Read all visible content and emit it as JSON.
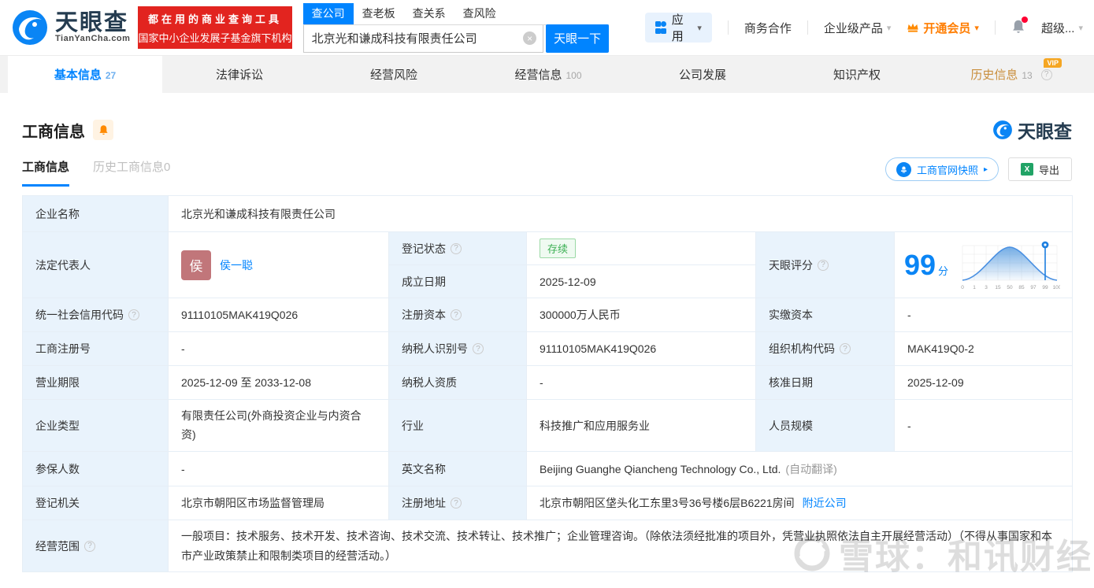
{
  "brand": {
    "name": "天眼查",
    "domain": "TianYanCha.com",
    "promo_line1": "都在用的商业查询工具",
    "promo_line2": "国家中小企业发展子基金旗下机构"
  },
  "search": {
    "tabs": [
      "查公司",
      "查老板",
      "查关系",
      "查风险"
    ],
    "query": "北京光和谦成科技有限责任公司",
    "submit": "天眼一下"
  },
  "topnav": {
    "apps": "应用",
    "cooperation": "商务合作",
    "enterprise": "企业级产品",
    "vip": "开通会员",
    "super": "超级..."
  },
  "nav_tabs": [
    {
      "label": "基本信息",
      "count": "27"
    },
    {
      "label": "法律诉讼",
      "count": ""
    },
    {
      "label": "经营风险",
      "count": ""
    },
    {
      "label": "经营信息",
      "count": "100"
    },
    {
      "label": "公司发展",
      "count": ""
    },
    {
      "label": "知识产权",
      "count": ""
    },
    {
      "label": "历史信息",
      "count": "13",
      "badge": "VIP"
    }
  ],
  "section": {
    "title": "工商信息",
    "subtab_active": "工商信息",
    "subtab_history": "历史工商信息0",
    "snapshot_button": "工商官网快照",
    "export_button": "导出",
    "brand_watermark": "天眼查"
  },
  "fields": {
    "company_name": {
      "label": "企业名称",
      "value": "北京光和谦成科技有限责任公司"
    },
    "legal_rep": {
      "label": "法定代表人",
      "avatar": "侯",
      "name": "侯一聪"
    },
    "reg_status": {
      "label": "登记状态",
      "value": "存续"
    },
    "establish_date": {
      "label": "成立日期",
      "value": "2025-12-09"
    },
    "score": {
      "label": "天眼评分",
      "value": "99",
      "unit": "分"
    },
    "credit_code": {
      "label": "统一社会信用代码",
      "value": "91110105MAK419Q026"
    },
    "reg_capital": {
      "label": "注册资本",
      "value": "300000万人民币"
    },
    "paid_capital": {
      "label": "实缴资本",
      "value": "-"
    },
    "reg_number": {
      "label": "工商注册号",
      "value": "-"
    },
    "taxpayer_id": {
      "label": "纳税人识别号",
      "value": "91110105MAK419Q026"
    },
    "org_code": {
      "label": "组织机构代码",
      "value": "MAK419Q0-2"
    },
    "business_term": {
      "label": "营业期限",
      "value": "2025-12-09 至 2033-12-08"
    },
    "taxpayer_quality": {
      "label": "纳税人资质",
      "value": "-"
    },
    "approval_date": {
      "label": "核准日期",
      "value": "2025-12-09"
    },
    "company_type": {
      "label": "企业类型",
      "value": "有限责任公司(外商投资企业与内资合资)"
    },
    "industry": {
      "label": "行业",
      "value": "科技推广和应用服务业"
    },
    "staff_size": {
      "label": "人员规模",
      "value": "-"
    },
    "insured_count": {
      "label": "参保人数",
      "value": "-"
    },
    "english_name": {
      "label": "英文名称",
      "value": "Beijing Guanghe Qiancheng Technology Co., Ltd.",
      "note": "(自动翻译)"
    },
    "reg_authority": {
      "label": "登记机关",
      "value": "北京市朝阳区市场监督管理局"
    },
    "reg_address": {
      "label": "注册地址",
      "value": "北京市朝阳区垡头化工东里3号36号楼6层B6221房间",
      "link": "附近公司"
    },
    "business_scope": {
      "label": "经营范围",
      "value": "一般项目：技术服务、技术开发、技术咨询、技术交流、技术转让、技术推广；企业管理咨询。（除依法须经批准的项目外，凭营业执照依法自主开展经营活动）（不得从事国家和本市产业政策禁止和限制类项目的经营活动。）"
    }
  },
  "chart_data": {
    "type": "line",
    "title": "天眼评分分布曲线",
    "x_ticks": [
      "0",
      "1",
      "3",
      "15",
      "50",
      "85",
      "97",
      "99",
      "100"
    ],
    "series": [
      {
        "name": "score-distribution",
        "x": [
          0,
          1,
          3,
          15,
          50,
          85,
          97,
          99,
          100
        ],
        "values": [
          0.02,
          0.05,
          0.12,
          0.45,
          1.0,
          0.45,
          0.12,
          0.05,
          0.02
        ]
      }
    ],
    "marker_x": "99",
    "score": 99,
    "grid": true,
    "legend": false
  },
  "icons": {
    "caret": "▾",
    "arrow_right": "▸",
    "clear": "×",
    "help": "?",
    "excel": "X"
  },
  "watermark": {
    "text": "雪球：和讯财经"
  }
}
